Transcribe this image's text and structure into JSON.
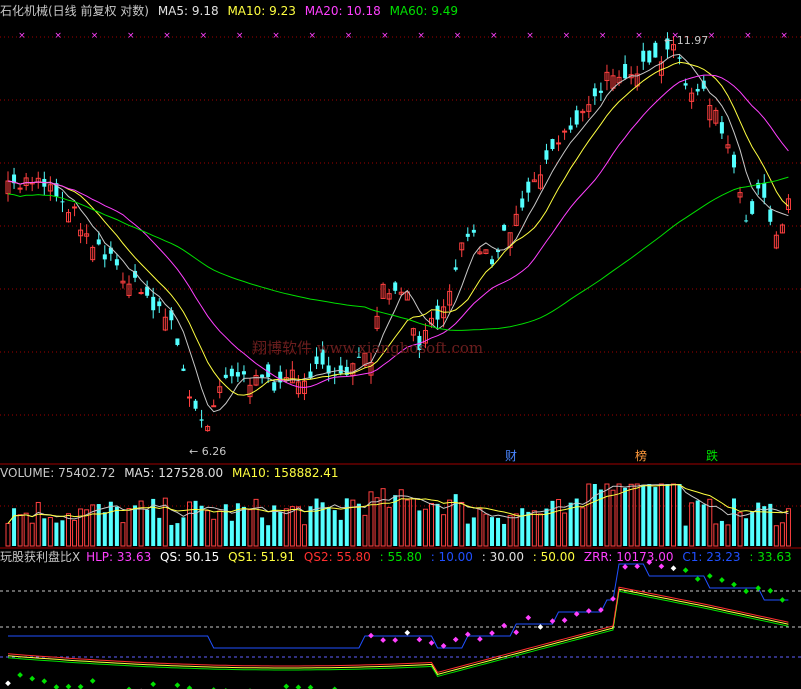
{
  "header": {
    "title": "石化机械(日线 前复权 对数)",
    "ma5": "MA5: 9.18",
    "ma10": "MA10: 9.23",
    "ma20": "MA20: 10.18",
    "ma60": "MA60: 9.49"
  },
  "annotations": {
    "high": "11.97",
    "low": "6.26"
  },
  "watermark": "翔博软件 www.xiangbosoft.com",
  "event_tags": [
    {
      "label": "财",
      "color": "#4a86ff"
    },
    {
      "label": "榜",
      "color": "#ff9a3c"
    },
    {
      "label": "跌",
      "color": "#00e000"
    }
  ],
  "volume_header": {
    "label": "VOLUME: 75402.72",
    "ma5": "MA5: 127528.00",
    "ma10": "MA10: 158882.41"
  },
  "indicator_header": {
    "name": "玩股获利盘比X",
    "hlp": "HLP: 33.63",
    "qs": "QS: 50.15",
    "qs1": "QS1: 51.91",
    "qs2": "QS2: 55.80",
    "v1": ": 55.80",
    "v2": ": 10.00",
    "v3": ": 30.00",
    "v4": ": 50.00",
    "zrr": "ZRR: 10173.00",
    "c1": "C1: 23.23",
    "v5": ": 33.63"
  },
  "colors": {
    "up": "#ff4040",
    "down": "#54ffff",
    "ma5": "#c8c8c8",
    "ma10": "#ffff40",
    "ma20": "#ff40ff",
    "ma60": "#00e000",
    "grid": "#a00000"
  }
}
